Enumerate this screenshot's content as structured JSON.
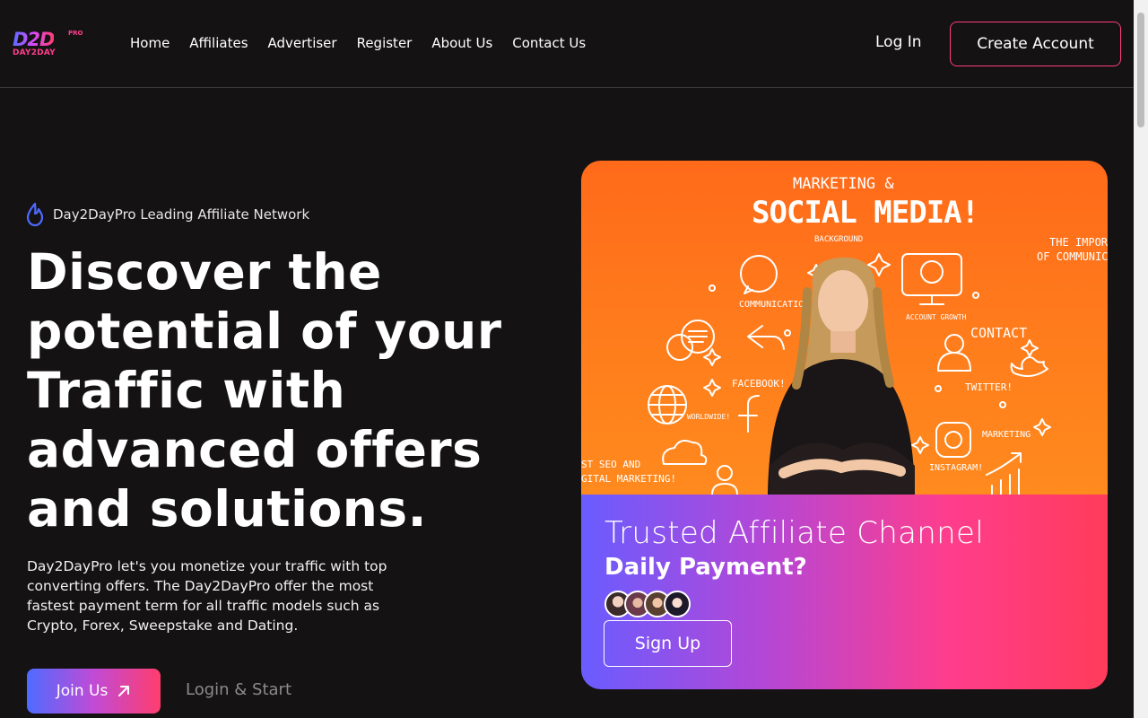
{
  "brand": {
    "logo_mark": "D2D",
    "logo_pro": "PRO",
    "logo_sub": "DAY2DAY"
  },
  "nav": {
    "items": [
      {
        "label": "Home"
      },
      {
        "label": "Affiliates"
      },
      {
        "label": "Advertiser"
      },
      {
        "label": "Register"
      },
      {
        "label": "About Us"
      },
      {
        "label": "Contact Us"
      }
    ],
    "login_label": "Log In",
    "create_account_label": "Create Account"
  },
  "hero": {
    "tagline": "Day2DayPro Leading Affiliate Network",
    "title": "Discover the potential of your Traffic with advanced offers and solutions.",
    "description": "Day2DayPro let's you monetize your traffic with top converting offers. The Day2DayPro offer the most fastest payment term for all traffic models such as Crypto, Forex, Sweepstake and Dating.",
    "join_label": "Join Us",
    "login_start_label": "Login & Start"
  },
  "card": {
    "image_title_small": "MARKETING &",
    "image_title_big": "SOCIAL MEDIA!",
    "image_caption": "BACKGROUND",
    "image_labels": {
      "communication": "COMMUNICATION",
      "account_growth": "ACCOUNT GROWTH",
      "contact": "CONTACT",
      "facebook": "FACEBOOK!",
      "worldwide": "WORLDWIDE!",
      "twitter": "TWITTER!",
      "marketing": "MARKETING",
      "instagram": "INSTAGRAM!",
      "seo_1": "ST SEO AND",
      "seo_2": "GITAL MARKETING!",
      "importance_1": "THE IMPORTA",
      "importance_2": "OF COMMUNICAT"
    },
    "title": "Trusted Affiliate Channel",
    "subtitle": "Daily Payment?",
    "signup_label": "Sign Up"
  },
  "colors": {
    "background": "#141213",
    "accent_pink": "#ff3d7a",
    "accent_blue": "#4e6bff",
    "card_orange": "#ff7d1c"
  }
}
